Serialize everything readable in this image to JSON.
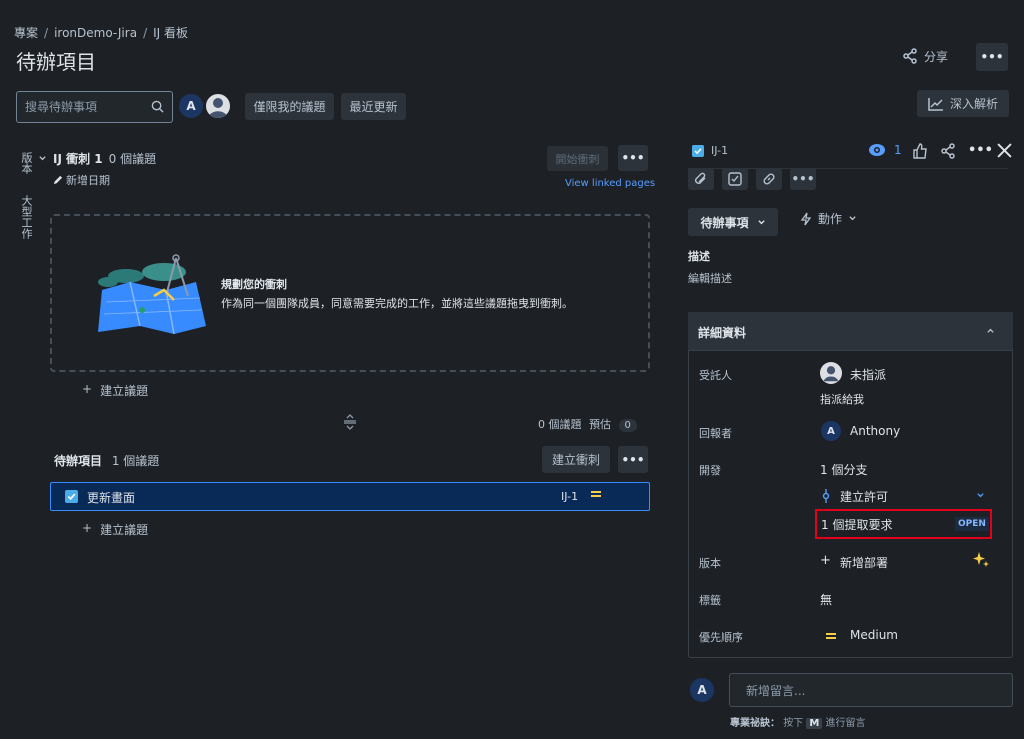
{
  "breadcrumb": [
    "專案",
    "ironDemo-Jira",
    "IJ 看板"
  ],
  "page_title": "待辦項目",
  "header": {
    "share_label": "分享",
    "more_label": "•••"
  },
  "search": {
    "placeholder": "搜尋待辦事項"
  },
  "avatars": {
    "current_user_initial": "A"
  },
  "filters": {
    "only_my_issues": "僅限我的議題",
    "recently_updated": "最近更新"
  },
  "insights_label": "深入解析",
  "side_tabs": {
    "version": "版本",
    "epic": "大型工作"
  },
  "sprint": {
    "name": "IJ 衝刺 1",
    "count": "0 個議題",
    "add_dates": "新增日期",
    "start_label": "開始衝刺",
    "view_linked": "View linked pages",
    "empty_title": "規劃您的衝刺",
    "empty_desc": "作為同一個團隊成員，同意需要完成的工作，並將這些議題拖曳到衝刺。",
    "create_issue": "建立議題",
    "stats_issues": "0 個議題",
    "stats_estimate_label": "預估",
    "stats_estimate": "0"
  },
  "backlog": {
    "title": "待辦項目",
    "count": "1 個議題",
    "create_sprint": "建立衝刺",
    "issues": [
      {
        "summary": "更新畫面",
        "key": "IJ-1"
      }
    ],
    "create_issue": "建立議題"
  },
  "issue_panel": {
    "key": "IJ-1",
    "watchers": "1",
    "status": "待辦事項",
    "actions": "動作",
    "description_label": "描述",
    "description_placeholder": "編輯描述",
    "details_title": "詳細資料",
    "fields": {
      "assignee_label": "受託人",
      "assignee_value": "未指派",
      "assign_to_me": "指派給我",
      "reporter_label": "回報者",
      "reporter_initial": "A",
      "reporter_value": "Anthony",
      "development_label": "開發",
      "branch": "1 個分支",
      "create_commit": "建立許可",
      "pull_request": "1 個提取要求",
      "pr_status": "OPEN",
      "version_label": "版本",
      "add_deployment": "新增部署",
      "labels_label": "標籤",
      "labels_value": "無",
      "priority_label": "優先順序",
      "priority_value": "Medium"
    },
    "comment": {
      "avatar_initial": "A",
      "placeholder": "新增留言...",
      "tip_prefix": "專業祕訣：",
      "tip_press": "按下",
      "tip_key": "M",
      "tip_suffix": "進行留言"
    }
  },
  "colors": {
    "accent": "#579dff",
    "priority_medium": "#f5cd47",
    "highlight_box": "#e2001a",
    "selected_row": "#092957"
  }
}
